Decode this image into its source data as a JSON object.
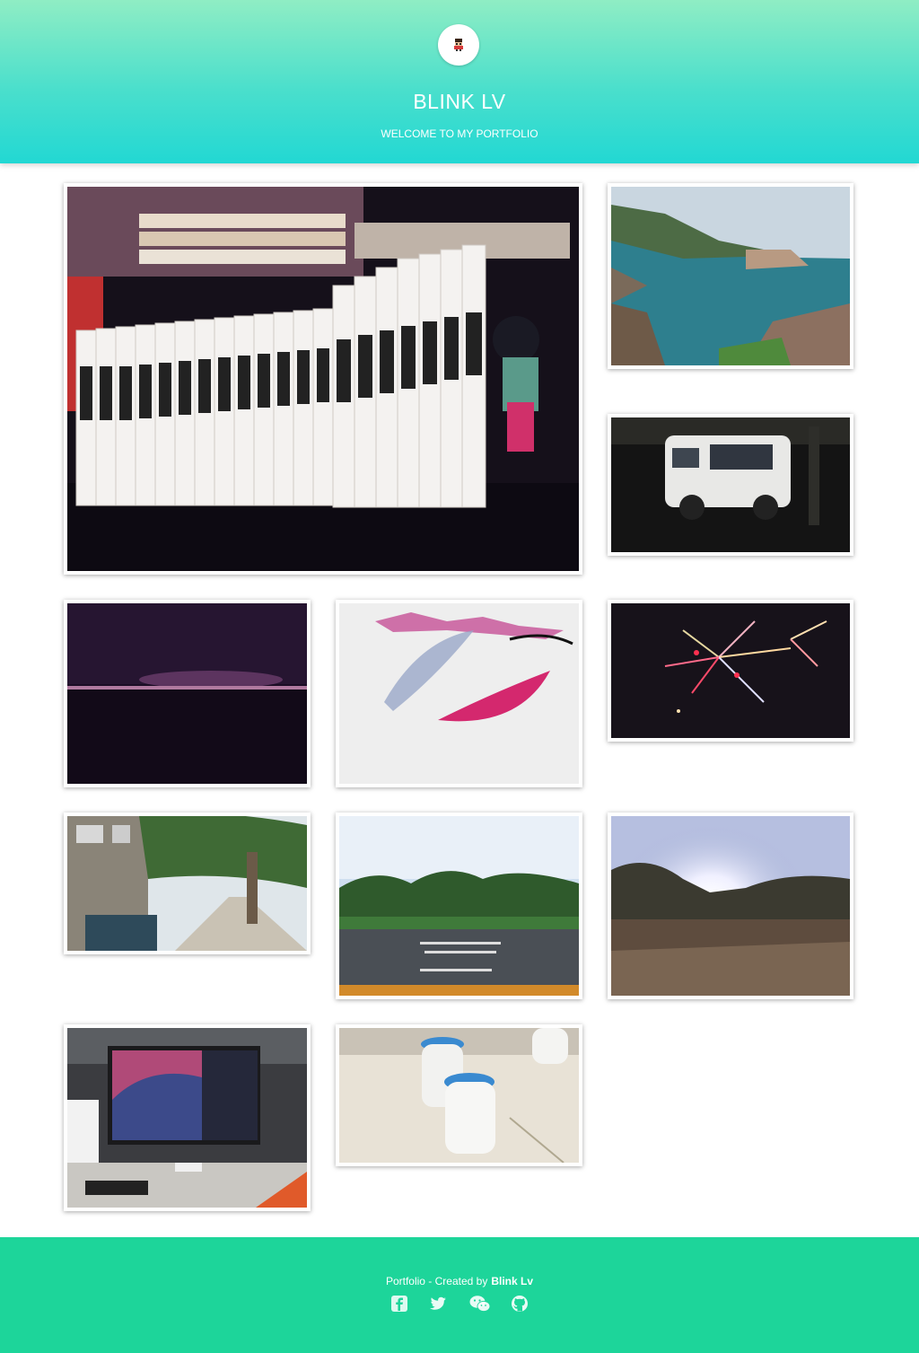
{
  "header": {
    "title": "BLINK LV",
    "subtitle": "WELCOME TO MY PORTFOLIO",
    "avatar_icon": "pixel-character-icon"
  },
  "gallery": {
    "photos": [
      {
        "subject": "manga-books-shelf"
      },
      {
        "subject": "coastline"
      },
      {
        "subject": "white-car"
      },
      {
        "subject": "night-skyline"
      },
      {
        "subject": "feather-painting"
      },
      {
        "subject": "fireworks"
      },
      {
        "subject": "tree-lined-alley"
      },
      {
        "subject": "road-and-trees"
      },
      {
        "subject": "sunlight-over-hill"
      },
      {
        "subject": "monitor-desk"
      },
      {
        "subject": "yogurt-jars"
      }
    ]
  },
  "footer": {
    "credit_prefix": "Portfolio - Created by",
    "credit_author": "Blink Lv",
    "social_icons": [
      "facebook-icon",
      "twitter-icon",
      "wechat-icon",
      "github-icon"
    ],
    "background": "#1dd59a"
  },
  "colors": {
    "header_top": "#8fedc4",
    "header_bottom": "#22d8d3",
    "text": "#ffffff"
  }
}
